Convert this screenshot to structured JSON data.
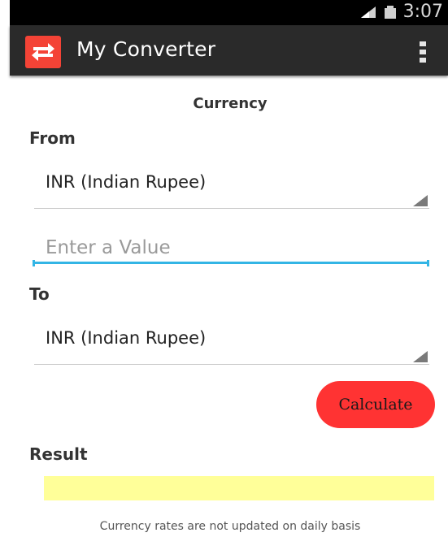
{
  "status_bar": {
    "time": "3:07",
    "icons": [
      "signal-icon",
      "battery-icon"
    ]
  },
  "action_bar": {
    "title": "My Converter",
    "logo_icon": "swap-arrows-icon",
    "menu_icon": "overflow-menu-icon"
  },
  "form": {
    "section_title": "Currency",
    "from_label": "From",
    "from_value": "INR (Indian Rupee)",
    "value_placeholder": "Enter a Value",
    "value_text": "",
    "to_label": "To",
    "to_value": "INR (Indian Rupee)",
    "calculate_label": "Calculate",
    "result_label": "Result",
    "result_value": "",
    "disclaimer": "Currency rates are not updated on daily basis"
  },
  "colors": {
    "action_bar": "#2a2a2a",
    "logo": "#f44336",
    "input_accent": "#33b5e5",
    "calculate_button": "#ff3333",
    "result_background": "#ffff99"
  }
}
